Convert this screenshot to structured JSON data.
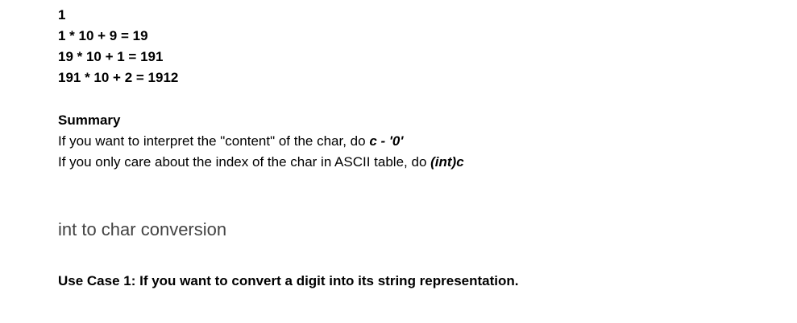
{
  "calc_lines": [
    "1",
    "1 * 10 + 9 = 19",
    "19 * 10 + 1 = 191",
    "191 * 10 + 2 = 1912"
  ],
  "summary": {
    "title": "Summary",
    "line1_text": "If you want to interpret the \"content\" of the char, do ",
    "line1_code": "c - '0'",
    "line2_text": "If you only care about the index of the char in ASCII table, do ",
    "line2_code": "(int)c"
  },
  "section": {
    "heading": "int to char conversion",
    "use_case_1": "Use Case 1: If you want to convert a digit into its string representation."
  },
  "colors": {
    "text": "#000000",
    "heading": "#434343",
    "background": "#ffffff"
  }
}
